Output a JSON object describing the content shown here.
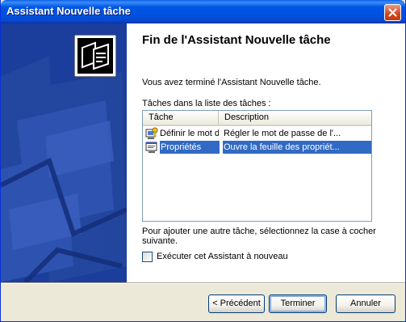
{
  "window": {
    "title": "Assistant Nouvelle tâche"
  },
  "content": {
    "heading": "Fin de l'Assistant Nouvelle tâche",
    "completed_text": "Vous avez terminé l'Assistant Nouvelle tâche.",
    "list_label": "Tâches dans la liste des tâches :",
    "list": {
      "columns": [
        "Tâche",
        "Description"
      ],
      "rows": [
        {
          "task": "Définir le mot d...",
          "description": "Régler le mot de passe de l'...",
          "icon": "key-monitor-icon",
          "selected": false
        },
        {
          "task": "Propriétés",
          "description": "Ouvre la feuille des propriét...",
          "icon": "properties-icon",
          "selected": true
        }
      ]
    },
    "add_instructions_line1": "Pour ajouter une autre tâche, sélectionnez la case à cocher",
    "add_instructions_line2": "suivante.",
    "rerun_checkbox_label": "Exécuter cet Assistant à nouveau",
    "rerun_checked": false
  },
  "buttons": {
    "back": "< Précédent",
    "finish": "Terminer",
    "cancel": "Annuler"
  },
  "colors": {
    "titlebar": "#0055E5",
    "sidebar": "#1B3E9C",
    "selection": "#316AC5"
  }
}
